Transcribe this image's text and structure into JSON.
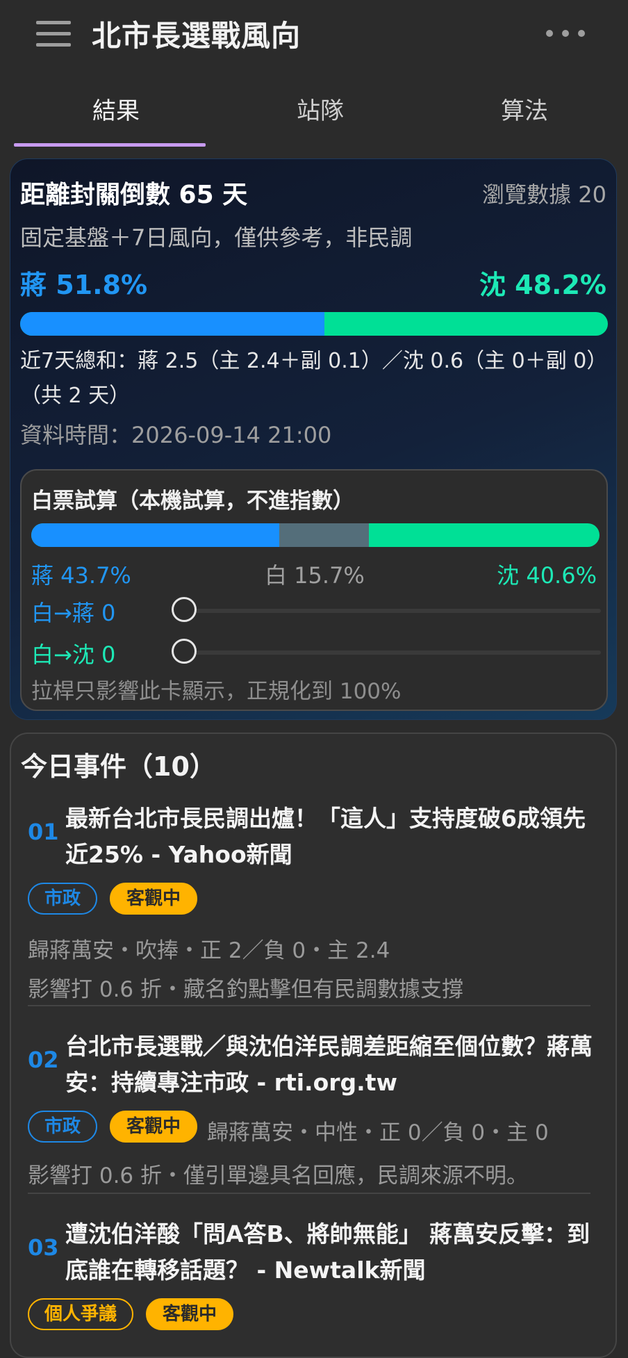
{
  "appbar": {
    "title": "北市長選戰風向",
    "menu_icon": "hamburger-menu-icon",
    "more_icon": "more-dots-icon"
  },
  "tabs": [
    {
      "label": "結果",
      "active": true
    },
    {
      "label": "站隊",
      "active": false
    },
    {
      "label": "算法",
      "active": false
    }
  ],
  "result": {
    "countdown": "距離封關倒數 65 天",
    "views": "瀏覽數據 20",
    "subtitle": "固定基盤＋7日風向，僅供參考，非民調",
    "blue_label": "蔣 51.8%",
    "green_label": "沈 48.2%",
    "blue_share": 51.8,
    "green_share": 48.2,
    "summary": "近7天總和：蔣 2.5（主 2.4＋副 0.1）／沈 0.6（主 0＋副 0）（共 2 天）",
    "data_time": "資料時間：2026-09-14 21:00"
  },
  "blank_sim": {
    "title": "白票試算（本機試算，不進指數）",
    "blue_label": "蔣 43.7%",
    "white_label": "白 15.7%",
    "green_label": "沈 40.6%",
    "blue_share": 43.7,
    "white_share": 15.7,
    "green_share": 40.6,
    "slider_to_blue": {
      "label": "白→蔣 0",
      "value": 0
    },
    "slider_to_green": {
      "label": "白→沈 0",
      "value": 0
    },
    "note": "拉桿只影響此卡顯示，正規化到 100%"
  },
  "events": {
    "title": "今日事件（10）",
    "items": [
      {
        "num": "01",
        "title": "最新台北市長民調出爐！「這人」支持度破6成領先近25% - Yahoo新聞",
        "tags": [
          "市政",
          "客觀中"
        ],
        "meta1": "歸蔣萬安・吹捧・正 2／負 0・主 2.4",
        "meta2": "影響打 0.6 折・藏名釣點擊但有民調數據支撐"
      },
      {
        "num": "02",
        "title": "台北市長選戰／與沈伯洋民調差距縮至個位數？蔣萬安：持續專注市政 - rti.org.tw",
        "tags": [
          "市政",
          "客觀中"
        ],
        "meta1": "歸蔣萬安・中性・正 0／負 0・主 0",
        "meta2": "影響打 0.6 折・僅引單邊具名回應，民調來源不明。"
      },
      {
        "num": "03",
        "title": "遭沈伯洋酸「問A答B、將帥無能」 蔣萬安反擊：到底誰在轉移話題？ - Newtalk新聞",
        "tags": [
          "個人爭議",
          "客觀中"
        ]
      }
    ]
  },
  "colors": {
    "blue": "#1890ff",
    "green": "#00e096",
    "white_seg": "#546e7a",
    "amber": "#ffb300",
    "tab_indicator": "#c79af0"
  }
}
